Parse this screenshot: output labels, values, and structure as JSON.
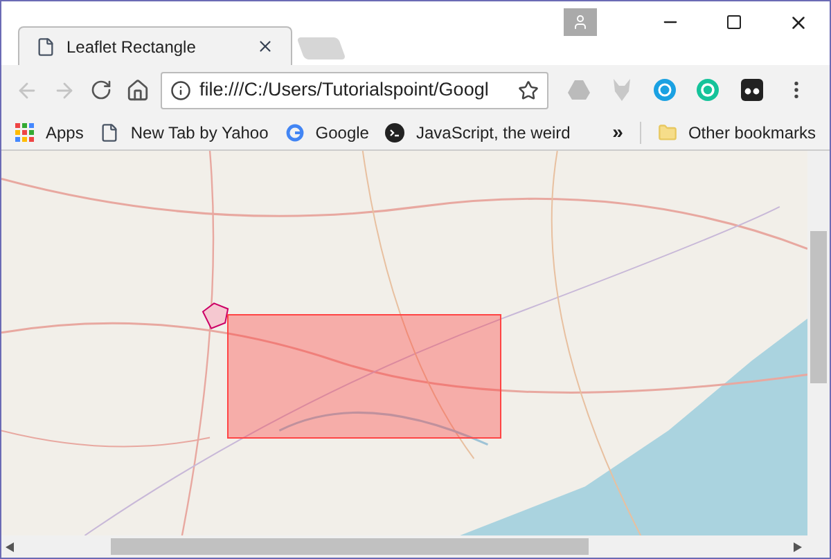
{
  "tabs": [
    {
      "title": "Leaflet Rectangle",
      "selected": true
    }
  ],
  "address_bar": {
    "value": "file:///C:/Users/Tutorialspoint/Googl"
  },
  "bookmarks": [
    {
      "label": "Apps",
      "kind": "apps"
    },
    {
      "label": "New Tab by Yahoo",
      "kind": "page"
    },
    {
      "label": "Google",
      "kind": "google"
    },
    {
      "label": "JavaScript, the weird",
      "kind": "terminal"
    }
  ],
  "overflow_label": "»",
  "other_bookmarks": "Other bookmarks"
}
